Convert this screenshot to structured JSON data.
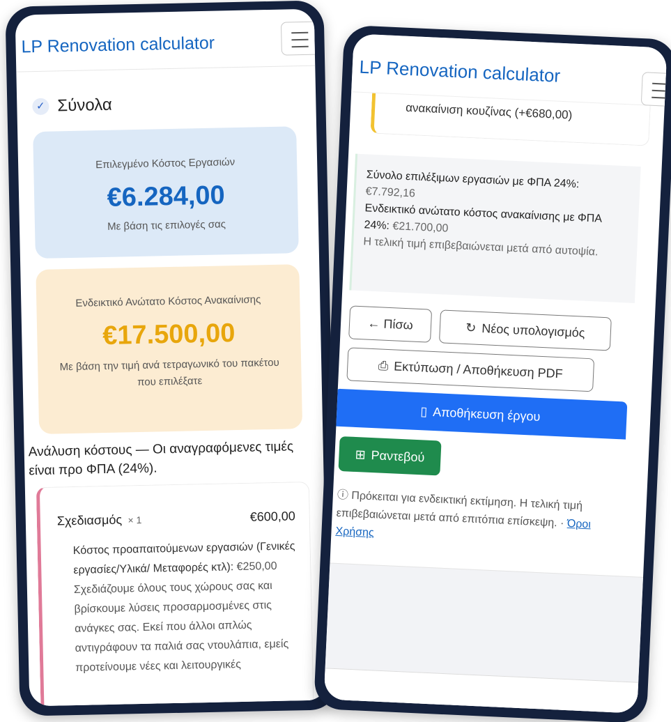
{
  "left_screen": {
    "nav": {
      "brand": "LP Renovation calculator",
      "menu_icon": "hamburger-icon"
    },
    "step": {
      "check_icon": "check-icon",
      "title": "Σύνολα"
    },
    "selected_cost": {
      "label": "Επιλεγμένο Κόστος Εργασιών",
      "value": "€6.284,00",
      "sub": "Με βάση τις επιλογές σας"
    },
    "max_cost": {
      "label": "Ενδεικτικό Ανώτατο Κόστος Ανακαίνισης",
      "value": "€17.500,00",
      "sub": "Με βάση την τιμή ανά τετραγωνικό του πακέτου που επιλέξατε"
    },
    "breakdown_heading": "Ανάλυση κόστους — Οι αναγραφόμενες τιμές είναι προ ΦΠΑ (24%).",
    "item": {
      "name": "Σχεδιασμός",
      "qty": "× 1",
      "price": "€600,00",
      "prereq_label": "Κόστος προαπαιτούμενων εργασιών (Γενικές εργασίες/Υλικά/ Μεταφορές κτλ):",
      "prereq_value": "€250,00",
      "description": "Σχεδιάζουμε όλους τους χώρους σας και βρίσκουμε λύσεις προσαρμοσμένες στις ανάγκες σας. Εκεί που άλλοι απλώς αντιγράφουν τα παλιά σας ντουλάπια, εμείς προτείνουμε νέες και λειτουργικές"
    }
  },
  "right_screen": {
    "nav": {
      "brand": "LP Renovation calculator",
      "menu_icon": "hamburger-icon"
    },
    "prev_item_text": "ανακαίνιση κουζίνας (+€680,00)",
    "summary": {
      "eligible_label": "Σύνολο επιλέξιμων εργασιών με ΦΠΑ 24%:",
      "eligible_value": "€7.792,16",
      "max_label": "Ενδεικτικό ανώτατο κόστος ανακαίνισης με ΦΠΑ 24%:",
      "max_value": "€21.700,00",
      "note": "Η τελική τιμή επιβεβαιώνεται μετά από αυτοψία."
    },
    "buttons": {
      "back": "← Πίσω",
      "new_calc": "Νέος υπολογισμός",
      "print": "Εκτύπωση / Αποθήκευση PDF",
      "save": "Αποθήκευση έργου",
      "appointment": "Ραντεβού"
    },
    "disclaimer": "Πρόκειται για ενδεικτική εκτίμηση. Η τελική τιμή επιβεβαιώνεται μετά από επιτόπια επίσκεψη. ·",
    "terms_link": "Όροι Χρήσης"
  },
  "colors": {
    "brand_blue": "#1565c0",
    "selected_card_bg": "#dce9f7",
    "max_card_bg": "#fcecd2",
    "max_value_amber": "#e8a60c",
    "save_button_blue": "#1f6ef5",
    "appointment_green": "#1f8b4d",
    "phone_frame": "#14213d"
  }
}
